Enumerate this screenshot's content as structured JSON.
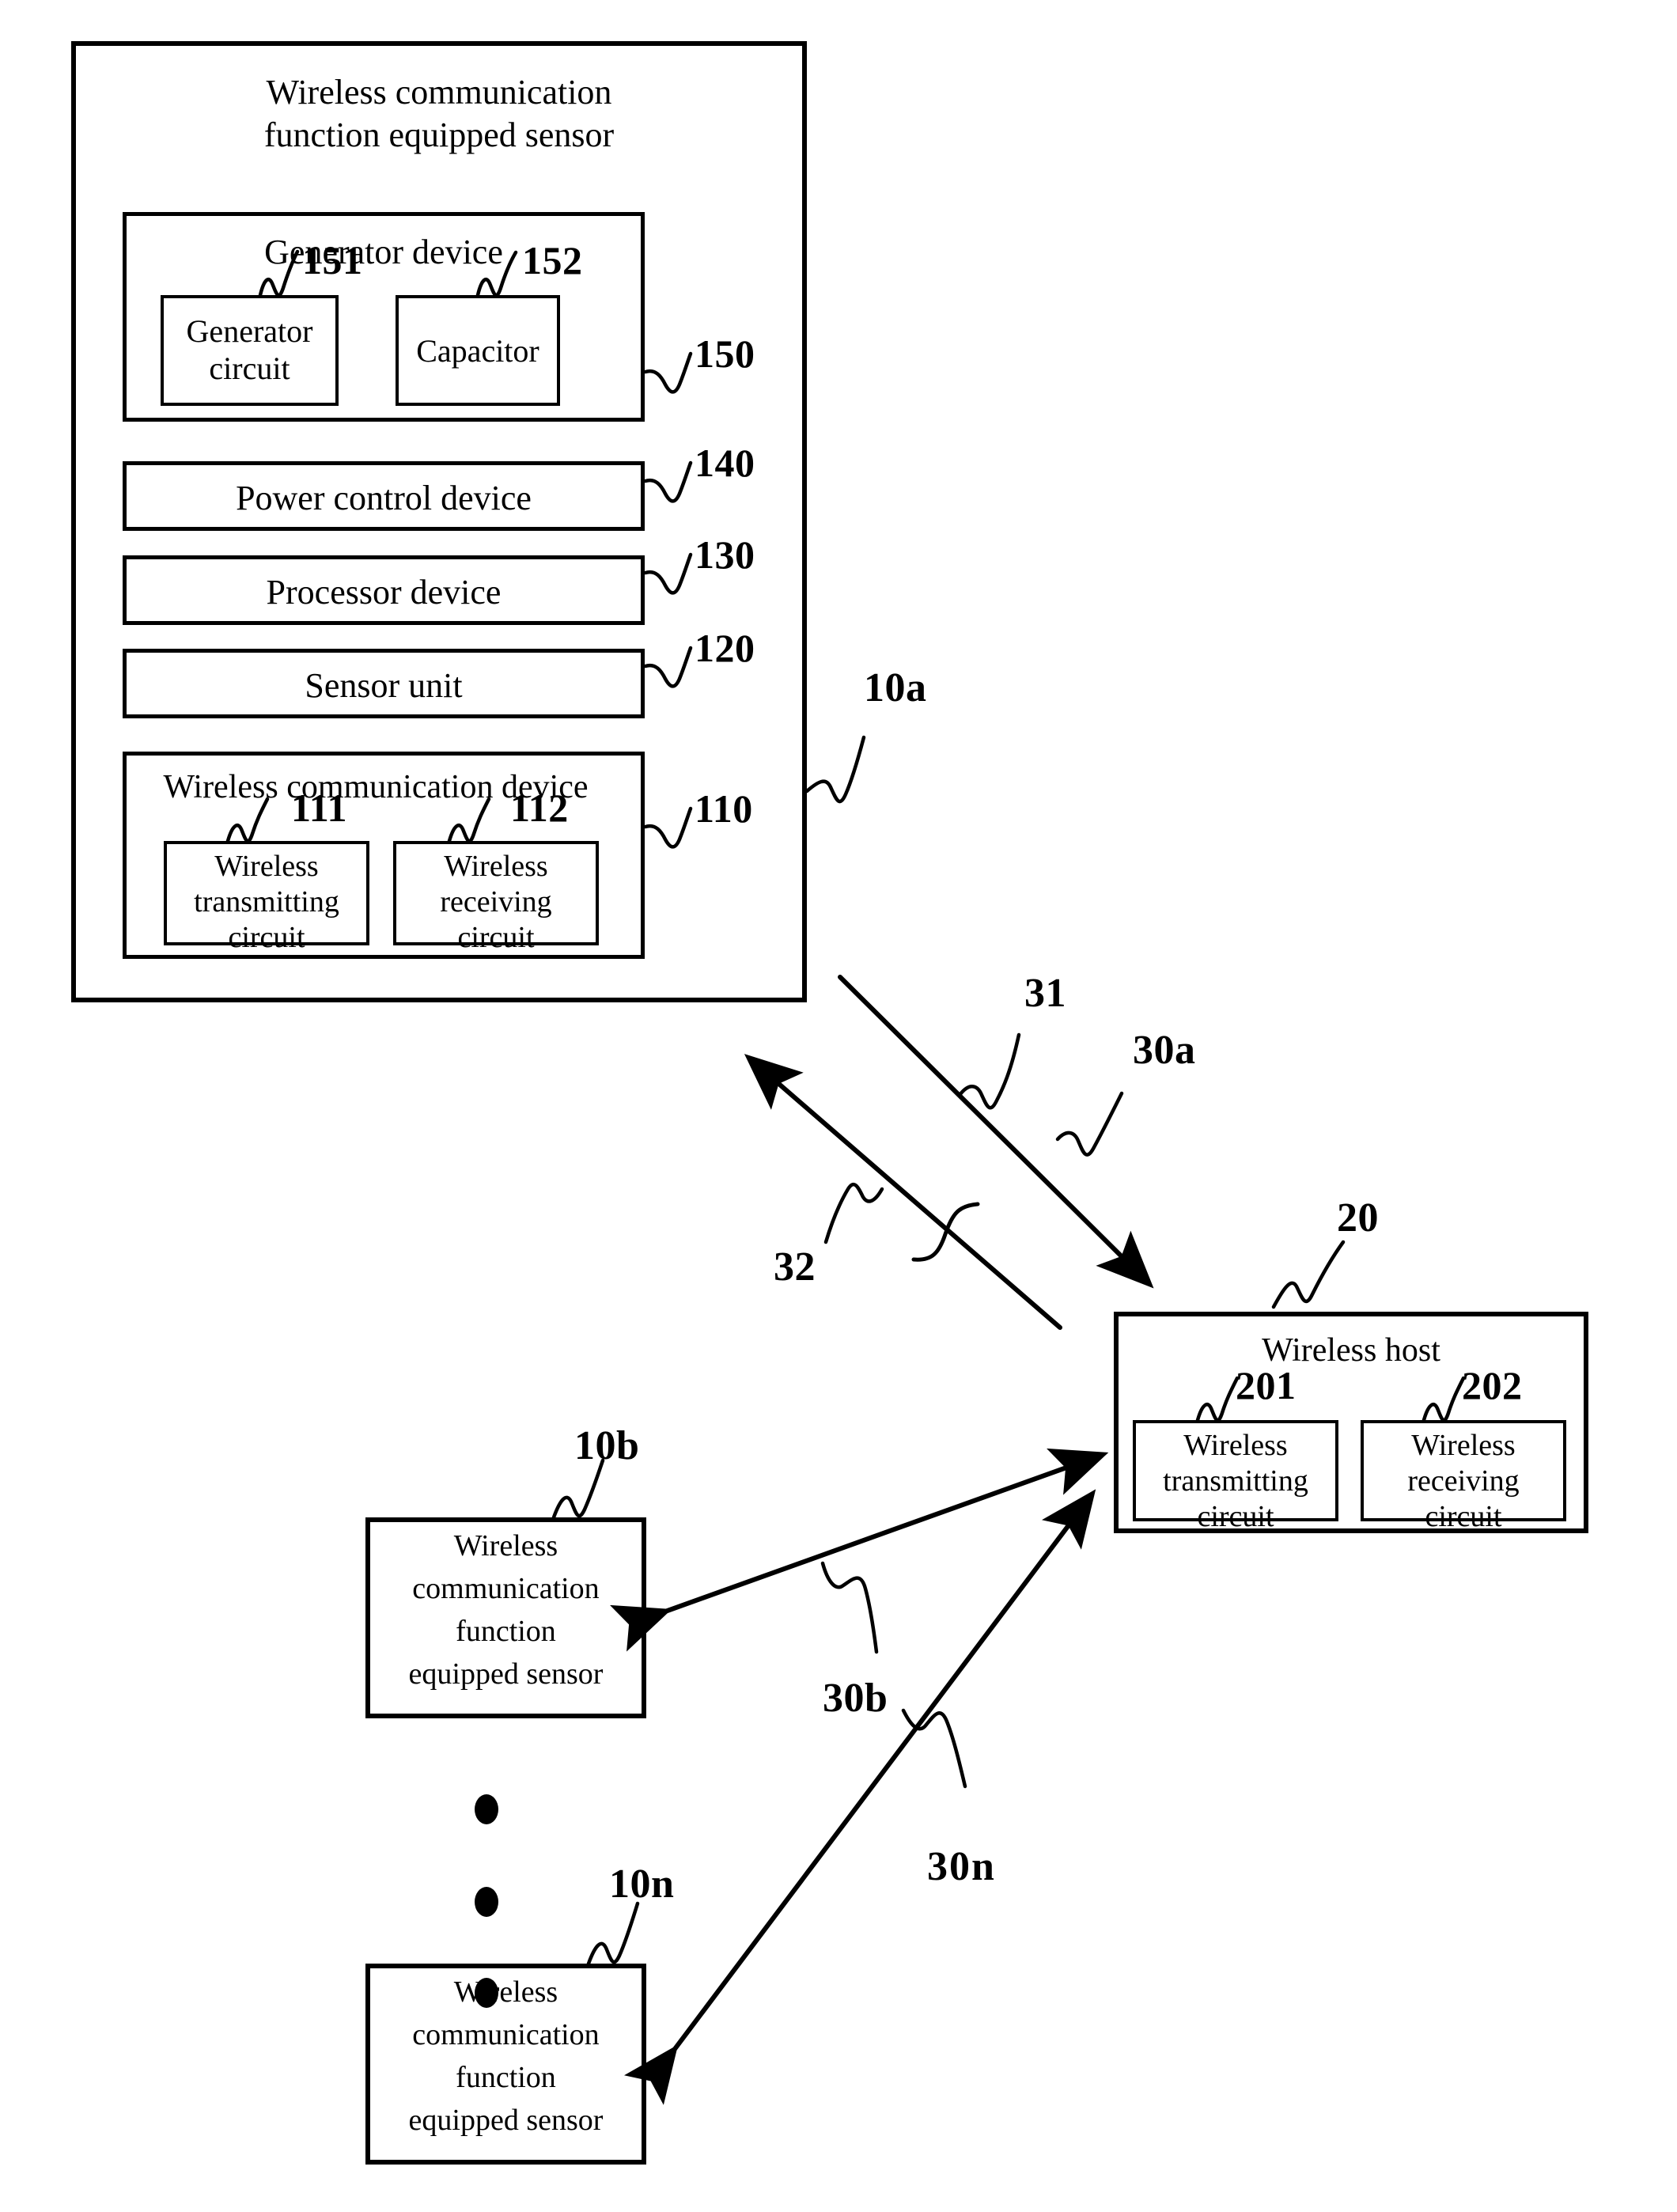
{
  "figure": {
    "kind": "patent-block-diagram",
    "ink_color": "#000000",
    "background_color": "#ffffff"
  },
  "sensor_a": {
    "title": "Wireless communication\nfunction equipped sensor",
    "ref": "10a",
    "generator_device": {
      "title": "Generator device",
      "ref": "150",
      "generator_circuit": {
        "label": "Generator\ncircuit",
        "ref": "151"
      },
      "capacitor": {
        "label": "Capacitor",
        "ref": "152"
      }
    },
    "power_control_device": {
      "label": "Power control device",
      "ref": "140"
    },
    "processor_device": {
      "label": "Processor device",
      "ref": "130"
    },
    "sensor_unit": {
      "label": "Sensor unit",
      "ref": "120"
    },
    "wireless_communication_device": {
      "title": "Wireless communication device",
      "ref": "110",
      "transmitting_circuit": {
        "label": "Wireless\ntransmitting\ncircuit",
        "ref": "111"
      },
      "receiving_circuit": {
        "label": "Wireless\nreceiving\ncircuit",
        "ref": "112"
      }
    }
  },
  "links_a": {
    "group_ref": "30a",
    "downlink_ref": "31",
    "uplink_ref": "32"
  },
  "host": {
    "title": "Wireless host",
    "ref": "20",
    "transmitting_circuit": {
      "label": "Wireless\ntransmitting\ncircuit",
      "ref": "201"
    },
    "receiving_circuit": {
      "label": "Wireless\nreceiving\ncircuit",
      "ref": "202"
    }
  },
  "sensor_b": {
    "label": "Wireless\ncommunication\nfunction\nequipped sensor",
    "ref": "10b",
    "link_ref": "30b"
  },
  "sensor_n": {
    "label": "Wireless\ncommunication\nfunction\nequipped sensor",
    "ref": "10n",
    "link_ref": "30n"
  },
  "ellipsis": {
    "dots": 3
  }
}
